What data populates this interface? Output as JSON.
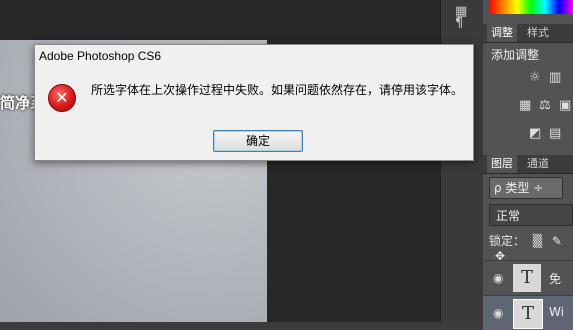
{
  "canvas": {
    "watermark_text": "简净系"
  },
  "toolbar": {
    "paragraph_icon": "paragraph-icon"
  },
  "panels": {
    "adjust_tabs": [
      {
        "label": "调整"
      },
      {
        "label": "样式"
      }
    ],
    "add_adjustment_label": "添加调整",
    "layer_tabs": [
      {
        "label": "图层"
      },
      {
        "label": "通道"
      }
    ],
    "filter_label": "ρ 类型 ÷",
    "blend_mode": "正常",
    "lock_label": "锁定：",
    "layers": [
      {
        "thumb_glyph": "T",
        "name": "免"
      },
      {
        "thumb_glyph": "T",
        "name": "Wi"
      }
    ]
  },
  "dialog": {
    "title": "Adobe Photoshop CS6",
    "message": "所选字体在上次操作过程中失败。如果问题依然存在，请停用该字体。",
    "ok_label": "确定",
    "icon": "error-icon"
  }
}
